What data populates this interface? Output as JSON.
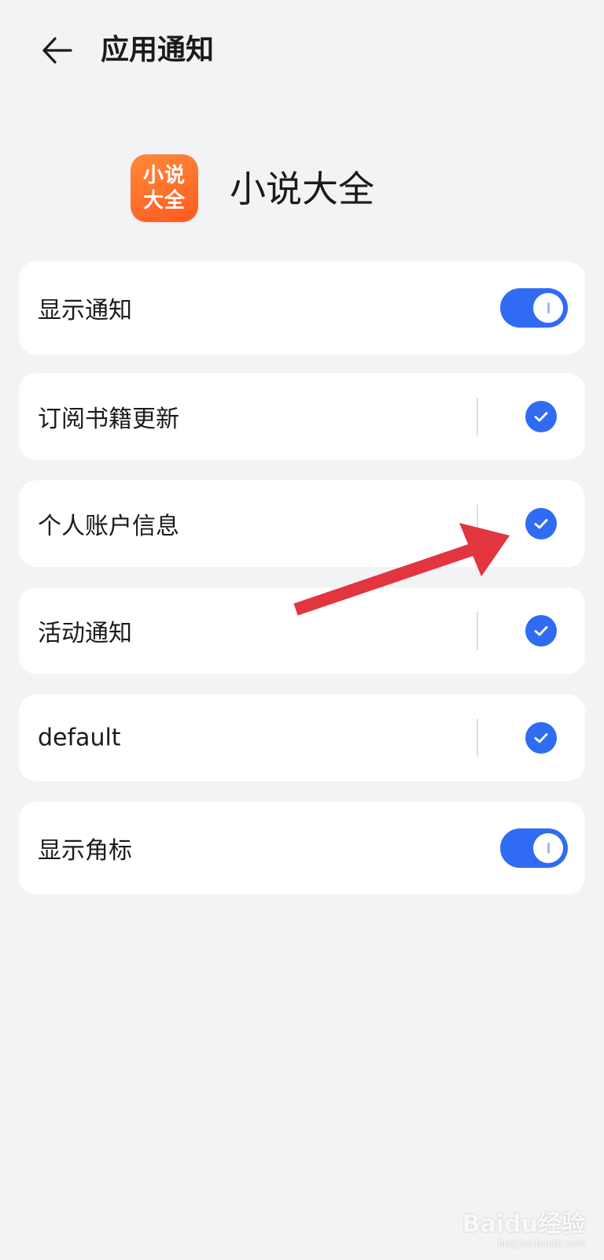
{
  "header": {
    "title": "应用通知",
    "back_icon": "arrow-left-icon"
  },
  "app": {
    "name": "小说大全",
    "icon_line1": "小说",
    "icon_line2": "大全",
    "icon_color": "#ff6a2a"
  },
  "settings": {
    "show_notifications": {
      "label": "显示通知",
      "enabled": true
    },
    "channels": [
      {
        "label": "订阅书籍更新",
        "checked": true
      },
      {
        "label": "个人账户信息",
        "checked": true
      },
      {
        "label": "活动通知",
        "checked": true
      },
      {
        "label": "default",
        "checked": true
      }
    ],
    "show_badge": {
      "label": "显示角标",
      "enabled": true
    }
  },
  "colors": {
    "accent": "#2f6cf3",
    "background": "#f1f3f5",
    "card": "#ffffff",
    "annotation_arrow": "#e2353f"
  },
  "watermark": {
    "brand": "Baidu经验",
    "url": "jingyan.baidu.com"
  }
}
